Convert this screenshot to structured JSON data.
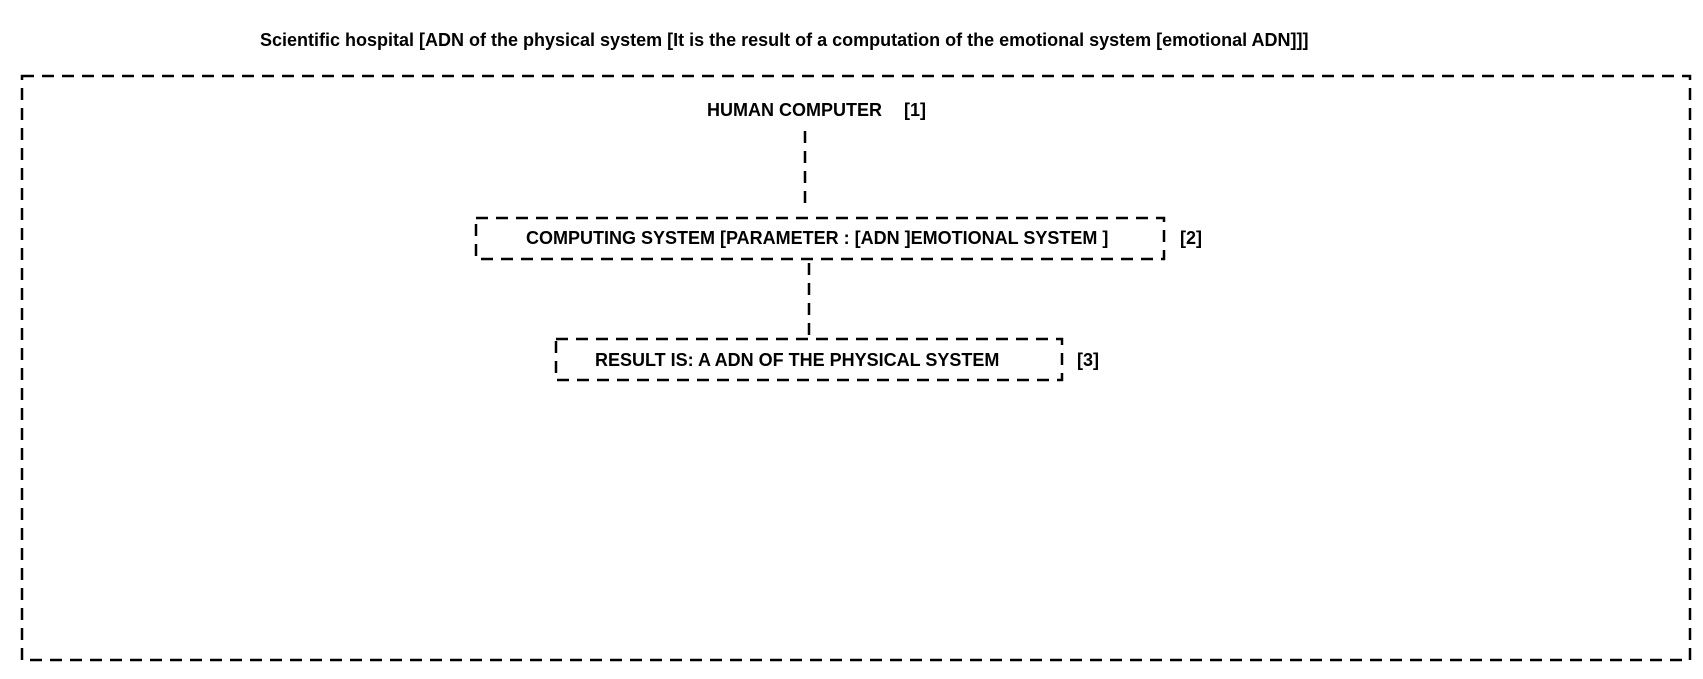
{
  "diagram": {
    "title": "Scientific hospital [ADN of the physical system [It is the result of a computation of the emotional system [emotional ADN]]]",
    "node1": {
      "label": "HUMAN COMPUTER",
      "ref": "[1]"
    },
    "node2": {
      "label": "COMPUTING SYSTEM [PARAMETER : [ADN ]EMOTIONAL SYSTEM ]",
      "ref": "[2]"
    },
    "node3": {
      "label": "RESULT IS: A ADN OF THE PHYSICAL SYSTEM",
      "ref": "[3]"
    }
  },
  "colors": {
    "stroke": "#000000",
    "background": "#ffffff"
  }
}
